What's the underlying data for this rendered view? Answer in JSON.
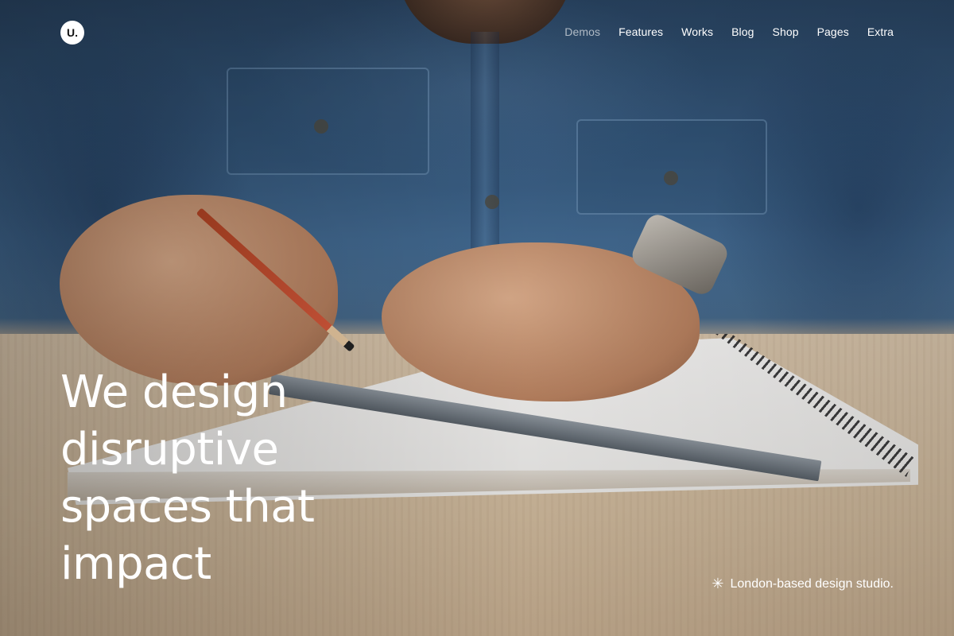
{
  "brand": {
    "logo_text": "U."
  },
  "nav": {
    "items": [
      {
        "label": "Demos",
        "active": true
      },
      {
        "label": "Features",
        "active": false
      },
      {
        "label": "Works",
        "active": false
      },
      {
        "label": "Blog",
        "active": false
      },
      {
        "label": "Shop",
        "active": false
      },
      {
        "label": "Pages",
        "active": false
      },
      {
        "label": "Extra",
        "active": false
      }
    ]
  },
  "hero": {
    "headline_lines": [
      "We design",
      "disruptive",
      "spaces that",
      "impact"
    ],
    "tagline": "London-based design studio.",
    "tagline_icon": "asterisk-icon"
  },
  "colors": {
    "text": "#ffffff",
    "nav_active": "#b8c0c8"
  }
}
